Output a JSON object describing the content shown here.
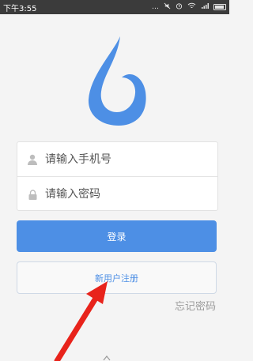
{
  "status_bar": {
    "time": "下午3:55",
    "icons": [
      "dots-icon",
      "mute-icon",
      "alarm-icon",
      "wifi-icon",
      "signal-icon",
      "battery-icon"
    ]
  },
  "logo": {
    "name": "water-drop-logo",
    "color": "#4d8fe5"
  },
  "form": {
    "phone_placeholder": "请输入手机号",
    "password_placeholder": "请输入密码"
  },
  "buttons": {
    "login_label": "登录",
    "register_label": "新用户注册"
  },
  "links": {
    "forgot_password": "忘记密码"
  },
  "colors": {
    "accent": "#4d8fe5",
    "background": "#f4f4f4",
    "annotation": "#e8231b"
  }
}
